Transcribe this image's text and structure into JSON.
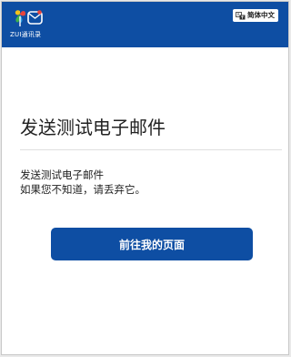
{
  "header": {
    "logo_icon": "zui-logo-icon",
    "logo_text": "ZUI通讯录",
    "language": {
      "icon": "language-icon",
      "label": "简体中文"
    },
    "color": "#0e4ea3"
  },
  "main": {
    "title": "发送测试电子邮件",
    "body_lines": [
      "发送测试电子邮件",
      "如果您不知道，请丢弃它。"
    ],
    "cta_label": "前往我的页面",
    "cta_color": "#0e4ea3"
  }
}
